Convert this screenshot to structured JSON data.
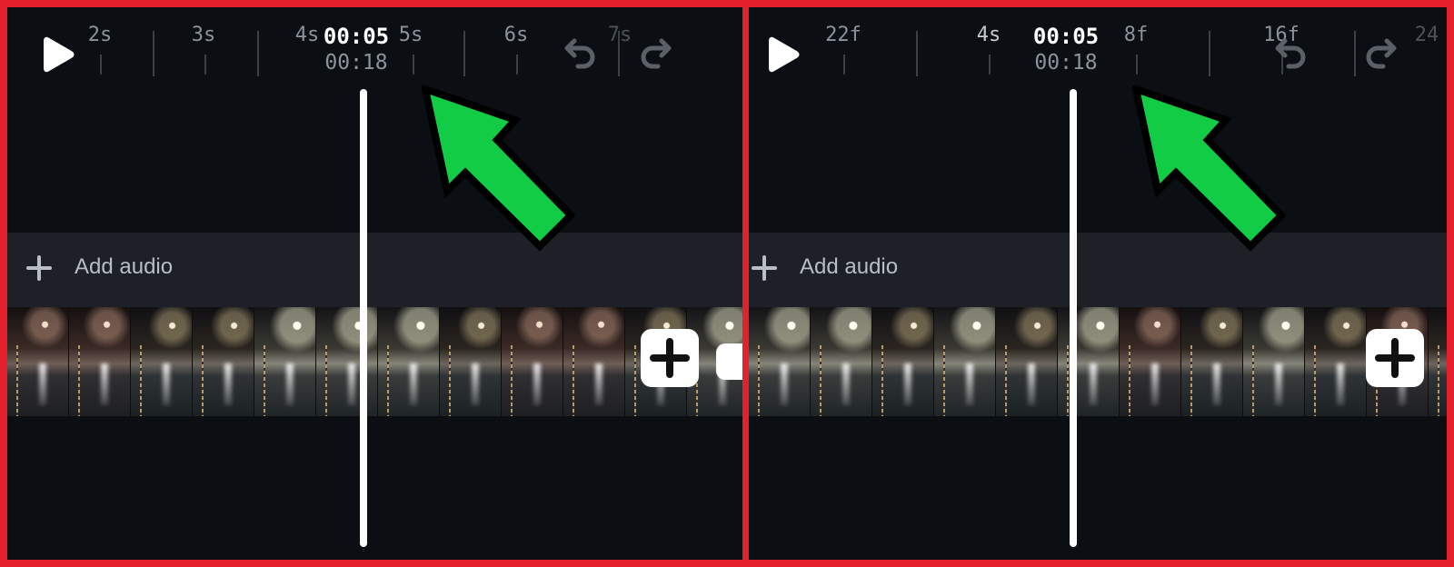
{
  "panels": [
    {
      "ruler": [
        "2s",
        "3s",
        "4s",
        "5s",
        "6s",
        "7s"
      ],
      "current_time": "00:05",
      "total_time": "00:18",
      "audio_label": "Add audio"
    },
    {
      "ruler": [
        "22f",
        "4s",
        "8f",
        "16f",
        "24"
      ],
      "current_time": "00:05",
      "total_time": "00:18",
      "audio_label": "Add audio"
    }
  ],
  "colors": {
    "frame_border": "#e3202b",
    "background": "#0b0e12",
    "audio_track": "#1d2127",
    "callout_arrow": "#12cc46"
  },
  "icons": [
    "play-icon",
    "undo-icon",
    "redo-icon",
    "plus-icon",
    "add-clip-icon",
    "callout-arrow-icon"
  ]
}
